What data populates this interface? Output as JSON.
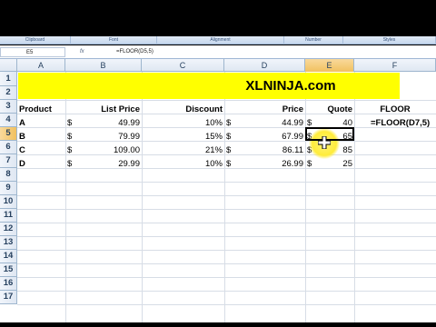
{
  "ribbon": {
    "groups": [
      "Clipboard",
      "Font",
      "Alignment",
      "Number",
      "Styles"
    ]
  },
  "formula_bar": {
    "name_box": "E5",
    "fx": "fx",
    "formula": "=FLOOR(D5,5)"
  },
  "columns": [
    "A",
    "B",
    "C",
    "D",
    "E",
    "F"
  ],
  "rows": [
    "1",
    "2",
    "3",
    "4",
    "5",
    "6",
    "7",
    "8",
    "9",
    "10",
    "11",
    "12",
    "13",
    "14",
    "15",
    "16",
    "17"
  ],
  "banner": "XLNINJA.com",
  "headers": {
    "product": "Product",
    "list_price": "List Price",
    "discount": "Discount",
    "price": "Price",
    "quote": "Quote",
    "floor": "FLOOR"
  },
  "currency": "$",
  "data_rows": [
    {
      "product": "A",
      "list_price": "49.99",
      "discount": "10%",
      "price": "44.99",
      "quote": "40",
      "floor": "=FLOOR(D7,5)"
    },
    {
      "product": "B",
      "list_price": "79.99",
      "discount": "15%",
      "price": "67.99",
      "quote": "65",
      "floor": ""
    },
    {
      "product": "C",
      "list_price": "109.00",
      "discount": "21%",
      "price": "86.11",
      "quote": "85",
      "floor": ""
    },
    {
      "product": "D",
      "list_price": "29.99",
      "discount": "10%",
      "price": "26.99",
      "quote": "25",
      "floor": ""
    }
  ],
  "colors": {
    "banner": "#ffff00",
    "selection_header": "#f1c15f",
    "highlight": "#ffec3a"
  }
}
